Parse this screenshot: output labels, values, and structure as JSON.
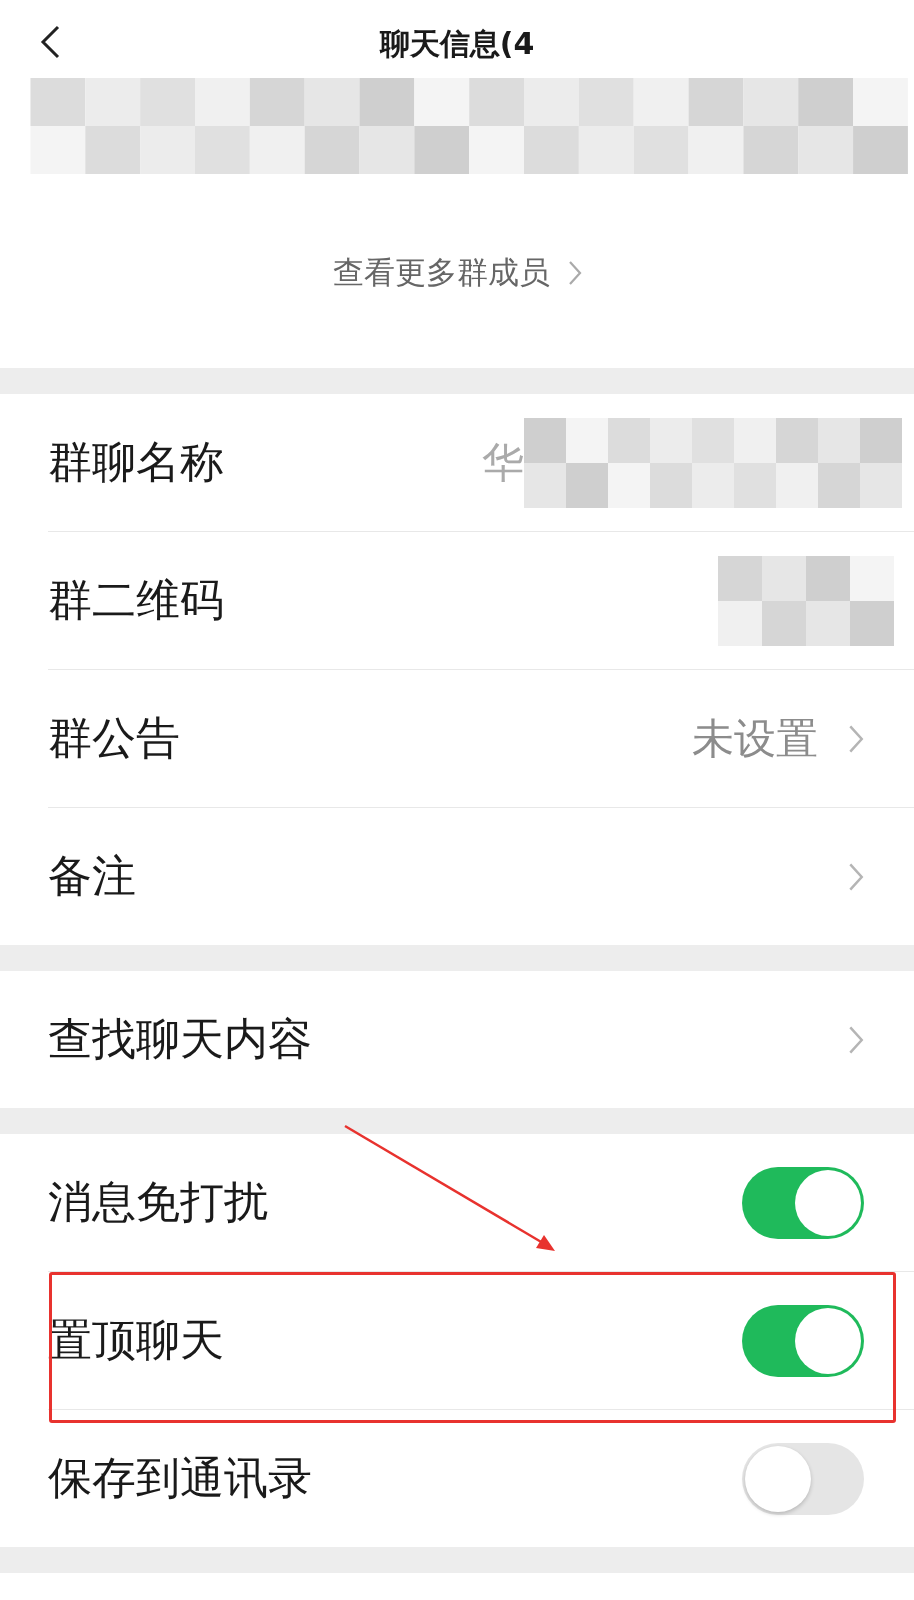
{
  "header": {
    "title": "聊天信息(4"
  },
  "more_members": {
    "label": "查看更多群成员"
  },
  "groups": [
    {
      "rows": [
        {
          "label": "群聊名称",
          "kind": "masked_value",
          "value": "华"
        },
        {
          "label": "群二维码",
          "kind": "masked"
        },
        {
          "label": "群公告",
          "kind": "value",
          "value": "未设置"
        },
        {
          "label": "备注",
          "kind": "link"
        }
      ]
    },
    {
      "rows": [
        {
          "label": "查找聊天内容",
          "kind": "link"
        }
      ]
    },
    {
      "rows": [
        {
          "label": "消息免打扰",
          "kind": "toggle",
          "on": true,
          "highlighted": false
        },
        {
          "label": "置顶聊天",
          "kind": "toggle",
          "on": true,
          "highlighted": true
        },
        {
          "label": "保存到通讯录",
          "kind": "toggle",
          "on": false,
          "highlighted": false
        }
      ]
    }
  ]
}
